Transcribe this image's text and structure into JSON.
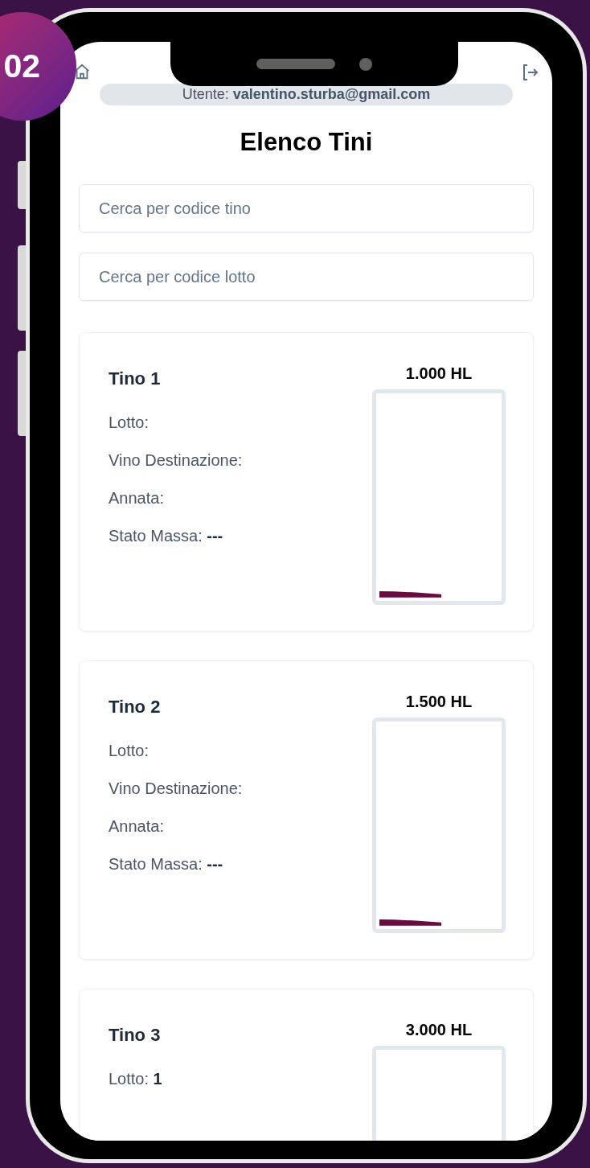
{
  "badge": "02",
  "user": {
    "label": "Utente:",
    "email": "valentino.sturba@gmail.com"
  },
  "title": "Elenco Tini",
  "search_fields": [
    {
      "placeholder": "Cerca per codice tino"
    },
    {
      "placeholder": "Cerca per codice lotto"
    }
  ],
  "tanks": [
    {
      "name": "Tino 1",
      "capacity": "1.000 HL",
      "level": 0.03,
      "fields": [
        {
          "label": "Lotto:"
        },
        {
          "label": "Vino Destinazione:"
        },
        {
          "label": "Annata:"
        },
        {
          "label": "Stato Massa:",
          "value": "---"
        }
      ]
    },
    {
      "name": "Tino 2",
      "capacity": "1.500 HL",
      "level": 0.03,
      "fields": [
        {
          "label": "Lotto:"
        },
        {
          "label": "Vino Destinazione:"
        },
        {
          "label": "Annata:"
        },
        {
          "label": "Stato Massa:",
          "value": "---"
        }
      ]
    },
    {
      "name": "Tino 3",
      "capacity": "3.000 HL",
      "fields": [
        {
          "label": "Lotto:",
          "value": "1"
        }
      ]
    }
  ]
}
